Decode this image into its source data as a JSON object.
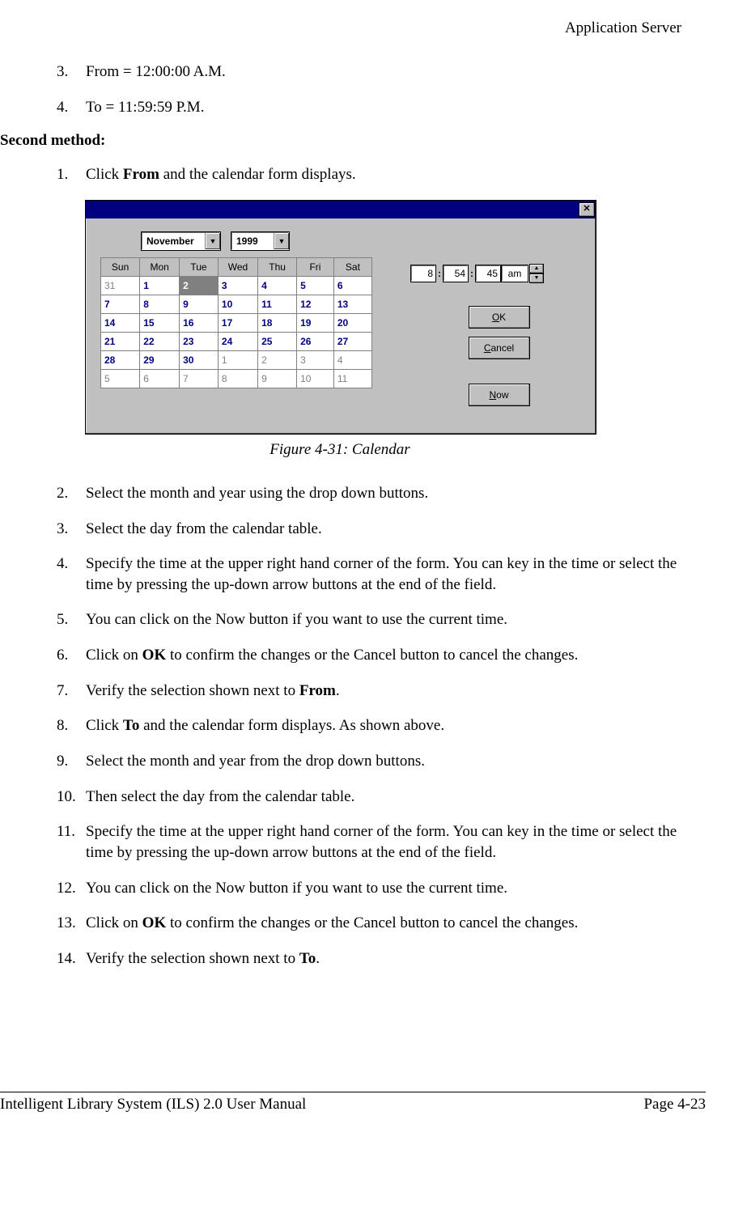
{
  "header": "Application Server",
  "top_list": [
    {
      "n": "3.",
      "text": "From = 12:00:00 A.M."
    },
    {
      "n": "4.",
      "text": "To = 11:59:59 P.M."
    }
  ],
  "section_heading": "Second method:",
  "step1": {
    "n": "1.",
    "pre": "Click ",
    "bold": "From",
    "post": " and the calendar form displays."
  },
  "caption": "Figure 4-31: Calendar",
  "steps": [
    {
      "n": "2.",
      "html": "Select the month and year using the drop down buttons."
    },
    {
      "n": "3.",
      "html": "Select the day from the calendar table."
    },
    {
      "n": "4.",
      "html": "Specify the time at the upper right hand corner of the form. You can key in the time or select the time by pressing the up-down arrow buttons at the end of the field."
    },
    {
      "n": "5.",
      "html": "You can click on the Now button if you want to use the current time."
    },
    {
      "n": "6.",
      "pre": "Click on ",
      "bold": "OK",
      "post": " to confirm the changes or the Cancel button to cancel the changes."
    },
    {
      "n": "7.",
      "pre": "Verify the selection shown next to ",
      "bold": "From",
      "post": "."
    },
    {
      "n": "8.",
      "pre": "Click ",
      "bold": "To",
      "post": " and the calendar form displays. As shown above."
    },
    {
      "n": "9.",
      "html": "Select the month and year from the drop down buttons."
    },
    {
      "n": "10.",
      "html": "Then select the day from the calendar table."
    },
    {
      "n": "11.",
      "html": "Specify the time at the upper right hand corner of the form. You can key in the time or select the time by pressing the up-down arrow buttons at the end of the field."
    },
    {
      "n": "12.",
      "html": "You can click on the Now button if you want to use the current time."
    },
    {
      "n": "13.",
      "pre": "Click on ",
      "bold": "OK",
      "post": " to confirm the changes or the Cancel button to cancel the changes."
    },
    {
      "n": "14.",
      "pre": "Verify the selection shown next to ",
      "bold": "To",
      "post": "."
    }
  ],
  "dialog": {
    "close": "✕",
    "month": "November",
    "year": "1999",
    "weekdays": [
      "Sun",
      "Mon",
      "Tue",
      "Wed",
      "Thu",
      "Fri",
      "Sat"
    ],
    "rows": [
      [
        {
          "d": "31",
          "in": false
        },
        {
          "d": "1",
          "in": true
        },
        {
          "d": "2",
          "in": true,
          "sel": true
        },
        {
          "d": "3",
          "in": true
        },
        {
          "d": "4",
          "in": true
        },
        {
          "d": "5",
          "in": true
        },
        {
          "d": "6",
          "in": true
        }
      ],
      [
        {
          "d": "7",
          "in": true
        },
        {
          "d": "8",
          "in": true
        },
        {
          "d": "9",
          "in": true
        },
        {
          "d": "10",
          "in": true
        },
        {
          "d": "11",
          "in": true
        },
        {
          "d": "12",
          "in": true
        },
        {
          "d": "13",
          "in": true
        }
      ],
      [
        {
          "d": "14",
          "in": true
        },
        {
          "d": "15",
          "in": true
        },
        {
          "d": "16",
          "in": true
        },
        {
          "d": "17",
          "in": true
        },
        {
          "d": "18",
          "in": true
        },
        {
          "d": "19",
          "in": true
        },
        {
          "d": "20",
          "in": true
        }
      ],
      [
        {
          "d": "21",
          "in": true
        },
        {
          "d": "22",
          "in": true
        },
        {
          "d": "23",
          "in": true
        },
        {
          "d": "24",
          "in": true
        },
        {
          "d": "25",
          "in": true
        },
        {
          "d": "26",
          "in": true
        },
        {
          "d": "27",
          "in": true
        }
      ],
      [
        {
          "d": "28",
          "in": true
        },
        {
          "d": "29",
          "in": true
        },
        {
          "d": "30",
          "in": true
        },
        {
          "d": "1",
          "in": false
        },
        {
          "d": "2",
          "in": false
        },
        {
          "d": "3",
          "in": false
        },
        {
          "d": "4",
          "in": false
        }
      ],
      [
        {
          "d": "5",
          "in": false
        },
        {
          "d": "6",
          "in": false
        },
        {
          "d": "7",
          "in": false
        },
        {
          "d": "8",
          "in": false
        },
        {
          "d": "9",
          "in": false
        },
        {
          "d": "10",
          "in": false
        },
        {
          "d": "11",
          "in": false
        }
      ]
    ],
    "time": {
      "hr": "8",
      "min": "54",
      "sec": "45",
      "ampm": "am"
    },
    "buttons": {
      "ok": {
        "u": "O",
        "rest": "K"
      },
      "cancel": {
        "u": "C",
        "rest": "ancel"
      },
      "now": {
        "u": "N",
        "rest": "ow"
      }
    }
  },
  "footer": {
    "left": "Intelligent Library System (ILS) 2.0 User Manual",
    "right": "Page 4-23"
  }
}
